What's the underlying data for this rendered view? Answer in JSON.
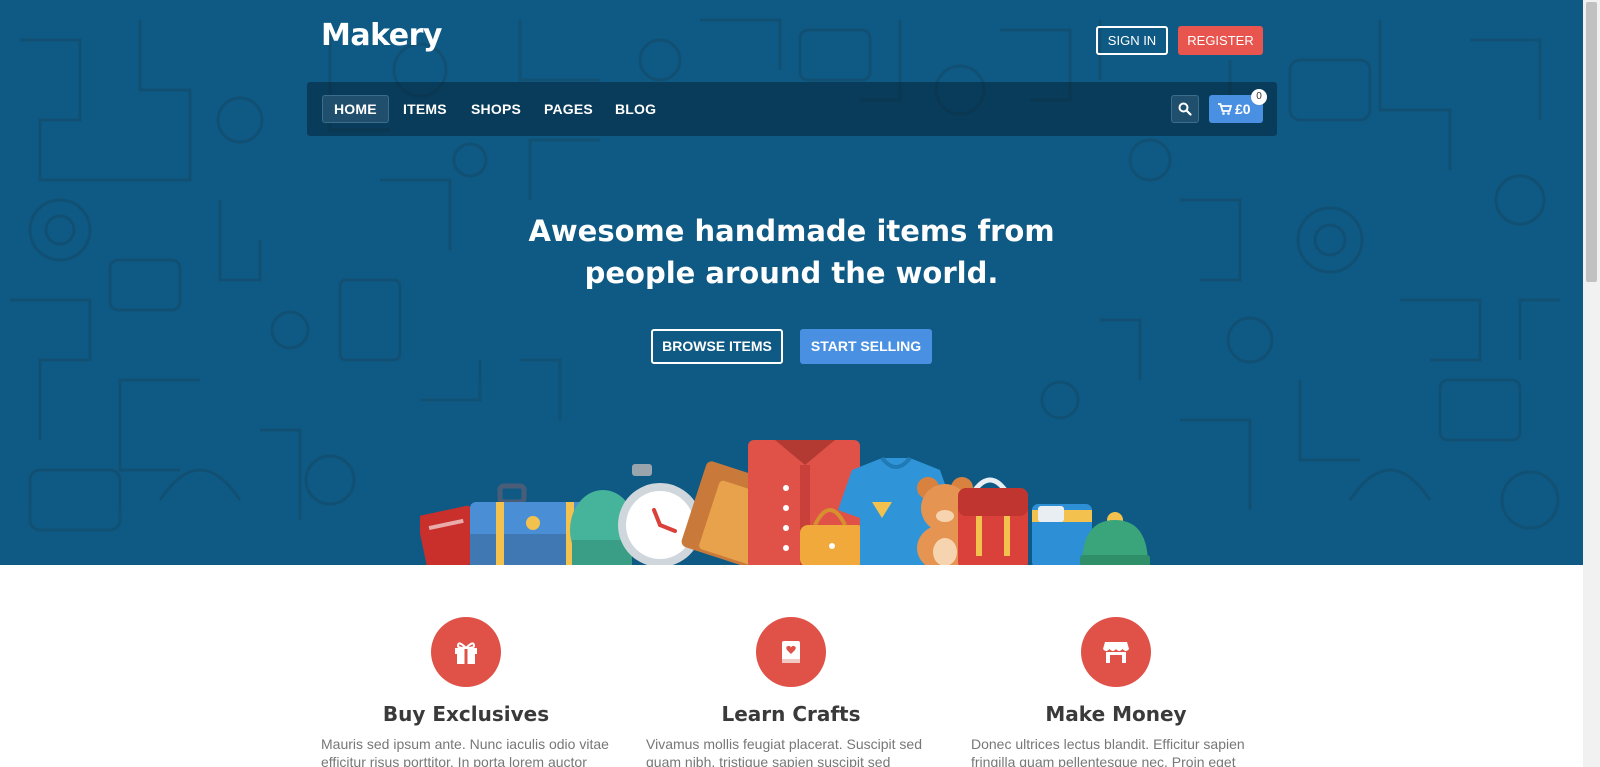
{
  "header": {
    "logo": "Makery",
    "sign_in": "SIGN IN",
    "register": "REGISTER"
  },
  "nav": {
    "items": [
      "HOME",
      "ITEMS",
      "SHOPS",
      "PAGES",
      "BLOG"
    ],
    "active": "HOME",
    "search_icon": "search-icon",
    "cart_total": "£0",
    "cart_count": "0"
  },
  "hero": {
    "headline_line1": "Awesome handmade items from",
    "headline_line2": "people around the world.",
    "browse_button": "BROWSE ITEMS",
    "selling_button": "START SELLING"
  },
  "features": [
    {
      "icon": "gift-icon",
      "title": "Buy Exclusives",
      "text": "Mauris sed ipsum ante. Nunc iaculis odio vitae efficitur risus porttitor. In porta lorem auctor"
    },
    {
      "icon": "book-heart-icon",
      "title": "Learn Crafts",
      "text": "Vivamus mollis feugiat placerat. Suscipit sed quam nibh, tristique sapien suscipit sed"
    },
    {
      "icon": "shop-icon",
      "title": "Make Money",
      "text": "Donec ultrices lectus blandit. Efficitur sapien fringilla quam pellentesque nec. Proin eget"
    }
  ],
  "colors": {
    "hero_bg": "#0e5a85",
    "accent_red": "#e8554e",
    "accent_blue": "#4a90e2"
  }
}
